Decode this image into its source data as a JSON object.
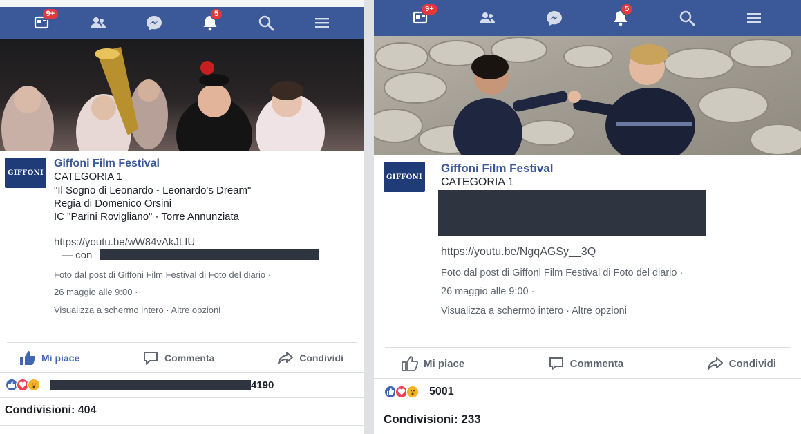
{
  "left": {
    "nav": {
      "badges": {
        "feed": "9+",
        "notifications": "5"
      },
      "icons": [
        "news-feed-icon",
        "friends-icon",
        "messenger-icon",
        "notifications-icon",
        "search-icon",
        "menu-icon"
      ]
    },
    "post": {
      "page_name": "Giffoni Film Festival",
      "logo_text": "GIFFONI",
      "lines": [
        "CATEGORIA 1",
        "\"Il Sogno di Leonardo - Leonardo's Dream\"",
        "Regia di Domenico Orsini",
        "IC \"Parini Rovigliano\" - Torre Annunziata"
      ],
      "link": "https://youtu.be/wW84vAkJLIU",
      "redacted_prefix": "— con",
      "meta": [
        "Foto dal post di Giffoni Film Festival di Foto del diario ·",
        "26 maggio alle 9:00 ·",
        "Visualizza a schermo intero · Altre opzioni"
      ]
    },
    "actions": {
      "like": "Mi piace",
      "comment": "Commenta",
      "share": "Condividi"
    },
    "reactions_count": "4190",
    "shares": "Condivisioni: 404"
  },
  "right": {
    "nav": {
      "badges": {
        "feed": "9+",
        "notifications": "5"
      }
    },
    "post": {
      "page_name": "Giffoni Film Festival",
      "logo_text": "GIFFONI",
      "lines": [
        "CATEGORIA 1"
      ],
      "link": "https://youtu.be/NgqAGSy__3Q",
      "meta": [
        "Foto dal post di Giffoni Film Festival di Foto del diario ·",
        "26 maggio alle 9:00 ·",
        "Visualizza a schermo intero · Altre opzioni"
      ]
    },
    "actions": {
      "like": "Mi piace",
      "comment": "Commenta",
      "share": "Condividi"
    },
    "reactions_count": "5001",
    "shares": "Condivisioni: 233"
  },
  "colors": {
    "brand": "#3b5998",
    "like": "#4267b2",
    "love": "#f33e58",
    "wow": "#f7b125",
    "badge": "#e0393e"
  }
}
